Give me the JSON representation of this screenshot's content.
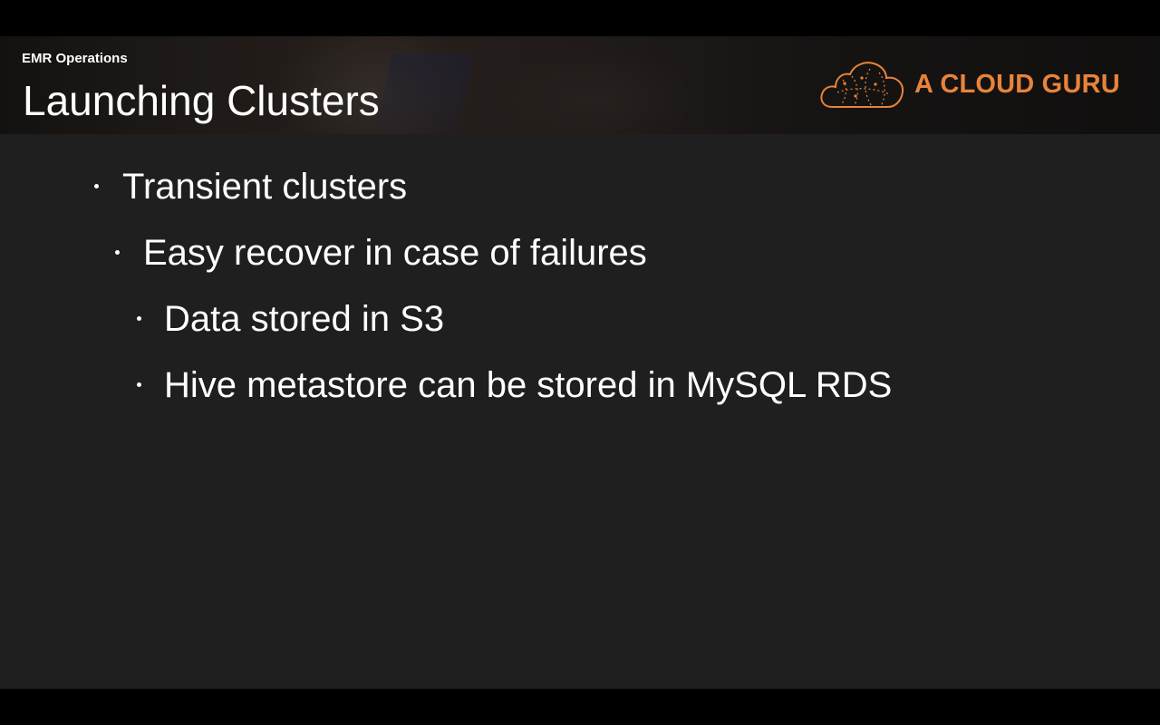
{
  "header": {
    "section_label": "EMR Operations",
    "title": "Launching Clusters",
    "logo_text": "A CLOUD GURU",
    "logo_icon": "cloud-icon",
    "logo_color": "#e8833a"
  },
  "bullets": [
    {
      "level": 1,
      "text": "Transient clusters"
    },
    {
      "level": 2,
      "text": "Easy recover in case of failures"
    },
    {
      "level": 3,
      "text": "Data stored in S3"
    },
    {
      "level": 3,
      "text": "Hive metastore can be stored in MySQL RDS"
    }
  ],
  "colors": {
    "slide_background": "#1f1f1f",
    "letterbox": "#000000",
    "text": "#ffffff"
  }
}
